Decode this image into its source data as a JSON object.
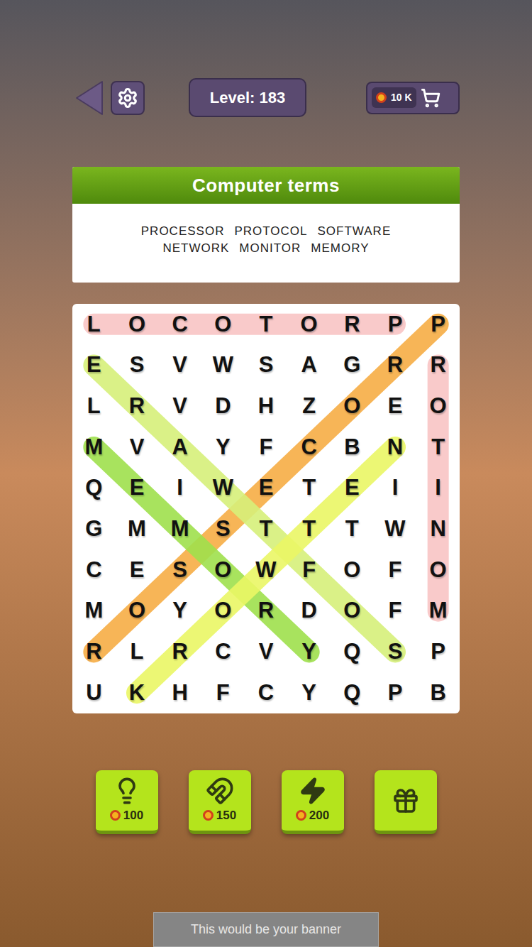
{
  "header": {
    "level": "Level: 183",
    "coins": "10 K"
  },
  "category": {
    "title": "Computer terms",
    "words": [
      "PROCESSOR",
      "PROTOCOL",
      "SOFTWARE",
      "NETWORK",
      "MONITOR",
      "MEMORY"
    ]
  },
  "board": {
    "rows": [
      [
        "L",
        "O",
        "C",
        "O",
        "T",
        "O",
        "R",
        "P",
        "P"
      ],
      [
        "E",
        "S",
        "V",
        "W",
        "S",
        "A",
        "G",
        "R",
        "R"
      ],
      [
        "L",
        "R",
        "V",
        "D",
        "H",
        "Z",
        "O",
        "E",
        "O"
      ],
      [
        "M",
        "V",
        "A",
        "Y",
        "F",
        "C",
        "B",
        "N",
        "T"
      ],
      [
        "Q",
        "E",
        "I",
        "W",
        "E",
        "T",
        "E",
        "I",
        "I"
      ],
      [
        "G",
        "M",
        "M",
        "S",
        "T",
        "T",
        "T",
        "W",
        "N"
      ],
      [
        "C",
        "E",
        "S",
        "O",
        "W",
        "F",
        "O",
        "F",
        "O"
      ],
      [
        "M",
        "O",
        "Y",
        "O",
        "R",
        "D",
        "O",
        "F",
        "M"
      ],
      [
        "R",
        "L",
        "R",
        "C",
        "V",
        "Y",
        "Q",
        "S",
        "P"
      ],
      [
        "U",
        "K",
        "H",
        "F",
        "C",
        "Y",
        "Q",
        "P",
        "B"
      ]
    ],
    "found": [
      {
        "word": "PROTOCOL",
        "color": "#f8c4c4",
        "start": [
          0,
          7
        ],
        "end": [
          0,
          0
        ]
      },
      {
        "word": "MONITOR",
        "color": "#f8c4c4",
        "start": [
          7,
          8
        ],
        "end": [
          1,
          8
        ]
      },
      {
        "word": "PROCESSOR",
        "color": "#f6ad45",
        "start": [
          0,
          8
        ],
        "end": [
          8,
          0
        ]
      },
      {
        "word": "SOFTWARE",
        "color": "#d6f07a",
        "start": [
          8,
          7
        ],
        "end": [
          1,
          0
        ]
      },
      {
        "word": "MEMORY",
        "color": "#9ee04c",
        "start": [
          3,
          0
        ],
        "end": [
          8,
          5
        ]
      },
      {
        "word": "NETWORK",
        "color": "#eaf665",
        "start": [
          3,
          7
        ],
        "end": [
          9,
          1
        ]
      }
    ]
  },
  "tools": [
    {
      "kind": "hint",
      "cost": "100"
    },
    {
      "kind": "magnet",
      "cost": "150"
    },
    {
      "kind": "bolt",
      "cost": "200"
    },
    {
      "kind": "gift",
      "cost": ""
    }
  ],
  "banner": "This would be your banner"
}
